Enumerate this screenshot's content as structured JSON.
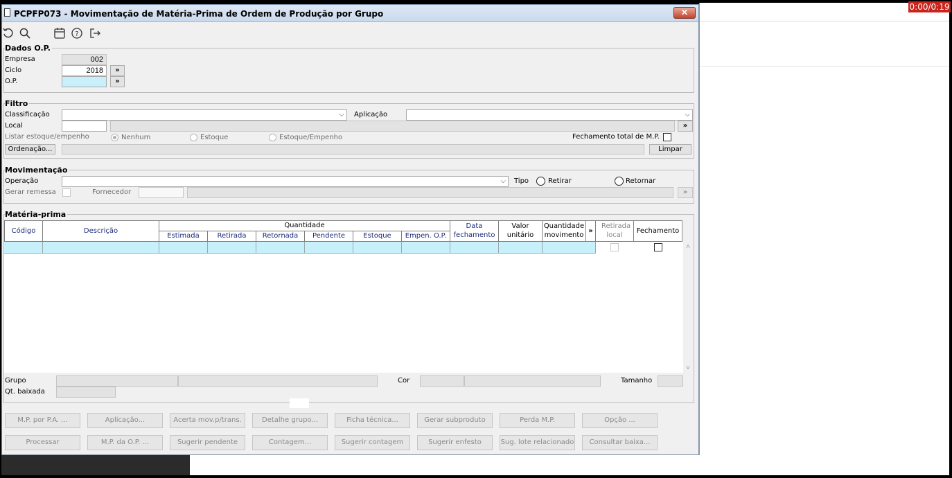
{
  "window": {
    "title": "PCPFP073 - Movimentação de Matéria-Prima de Ordem de Produção por Grupo",
    "close_symbol": "✕"
  },
  "timer": "0:00/0:19",
  "toolbar": {
    "icons": [
      "refresh-icon",
      "search-icon",
      "calendar-icon",
      "help-icon",
      "exit-icon"
    ]
  },
  "dados_op": {
    "title": "Dados O.P.",
    "empresa_label": "Empresa",
    "empresa_value": "002",
    "ciclo_label": "Ciclo",
    "ciclo_value": "2018",
    "op_label": "O.P.",
    "op_value": "",
    "more": "»"
  },
  "filtro": {
    "title": "Filtro",
    "classificacao_label": "Classificação",
    "classificacao_value": "",
    "aplicacao_label": "Aplicação",
    "aplicacao_value": "",
    "local_label": "Local",
    "local_value": "",
    "listar_label": "Listar estoque/empenho",
    "radio_nenhum": "Nenhum",
    "radio_estoque": "Estoque",
    "radio_estoque_empenho": "Estoque/Empenho",
    "fechamento_total_label": "Fechamento total de M.P.",
    "ordenacao_button": "Ordenação...",
    "limpar_button": "Limpar",
    "more": "»"
  },
  "movimentacao": {
    "title": "Movimentação",
    "operacao_label": "Operação",
    "operacao_value": "",
    "tipo_label": "Tipo",
    "retirar_label": "Retirar",
    "retornar_label": "Retornar",
    "gerar_remessa_label": "Gerar remessa",
    "fornecedor_label": "Fornecedor",
    "more": "»"
  },
  "materia_prima": {
    "title": "Matéria-prima",
    "columns": {
      "codigo": "Código",
      "descricao": "Descrição",
      "quantidade": "Quantidade",
      "estimada": "Estimada",
      "retirada": "Retirada",
      "retornada": "Retornada",
      "pendente": "Pendente",
      "estoque": "Estoque",
      "empen_op": "Empen. O.P.",
      "data_fechamento": "Data fechamento",
      "valor_unitario": "Valor unitário",
      "quantidade_movimento": "Quantidade movimento",
      "more": "»",
      "retirada_local": "Retirada local",
      "fechamento": "Fechamento"
    },
    "grupo_label": "Grupo",
    "cor_label": "Cor",
    "tamanho_label": "Tamanho",
    "qt_baixada_label": "Qt. baixada"
  },
  "buttons_row1": [
    "M.P. por P.A. ...",
    "Aplicação...",
    "Acerta mov.p/trans.",
    "Detalhe grupo...",
    "Ficha técnica...",
    "Gerar subproduto",
    "Perda M.P.",
    "Opção ..."
  ],
  "buttons_row2": [
    "Processar",
    "M.P. da O.P. ...",
    "Sugerir pendente",
    "Contagem...",
    "Sugerir contagem",
    "Sugerir enfesto",
    "Sug. lote relacionado",
    "Consultar baixa..."
  ]
}
